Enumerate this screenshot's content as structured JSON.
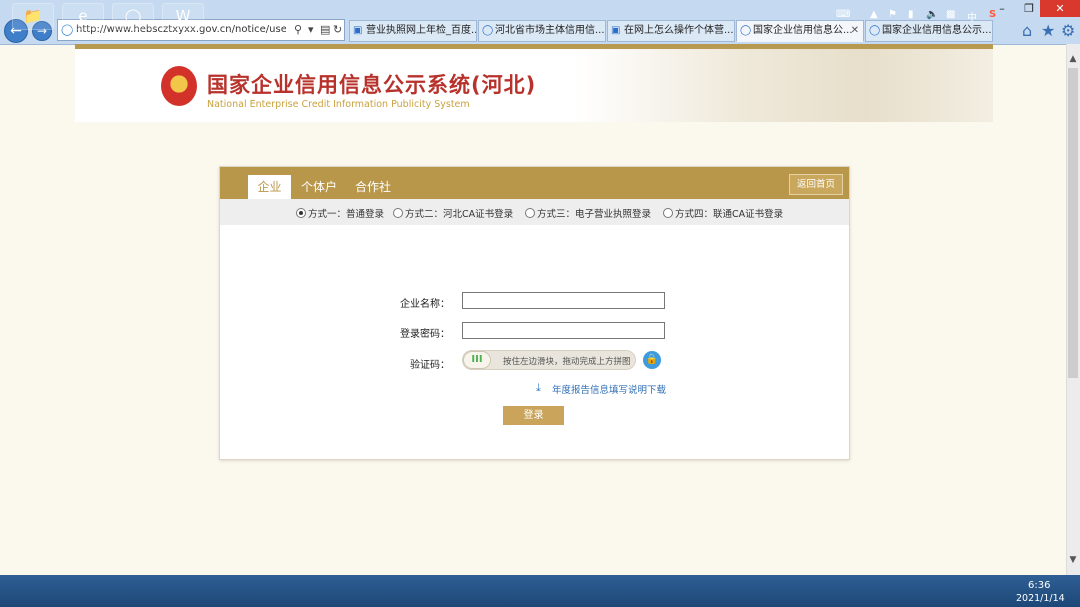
{
  "browser": {
    "url": "http://www.hebscztxyxx.gov.cn/notice/user/pop",
    "tabs": [
      {
        "title": "营业执照网上年检_百度..."
      },
      {
        "title": "河北省市场主体信用信..."
      },
      {
        "title": "在网上怎么操作个体营..."
      },
      {
        "title": "国家企业信用信息公...",
        "active": true
      },
      {
        "title": "国家企业信用信息公示..."
      }
    ]
  },
  "header": {
    "title_cn": "国家企业信用信息公示系统(河北)",
    "title_en": "National Enterprise Credit Information Publicity System"
  },
  "login": {
    "tabs": [
      "企业",
      "个体户",
      "合作社"
    ],
    "active_tab": "企业",
    "home_button": "返回首页",
    "methods": [
      {
        "label": "方式一：普通登录",
        "selected": true
      },
      {
        "label": "方式二：河北CA证书登录",
        "selected": false
      },
      {
        "label": "方式三：电子营业执照登录",
        "selected": false
      },
      {
        "label": "方式四：联通CA证书登录",
        "selected": false
      }
    ],
    "fields": {
      "company_label": "企业名称：",
      "company_value": "",
      "password_label": "登录密码：",
      "password_value": "",
      "captcha_label": "验证码："
    },
    "slider_hint": "按住左边滑块，拖动完成上方拼图",
    "download_link": "年度报告信息填写说明下载",
    "submit": "登录"
  },
  "taskbar": {
    "time": "6:36",
    "date": "2021/1/14",
    "ime": "中"
  }
}
